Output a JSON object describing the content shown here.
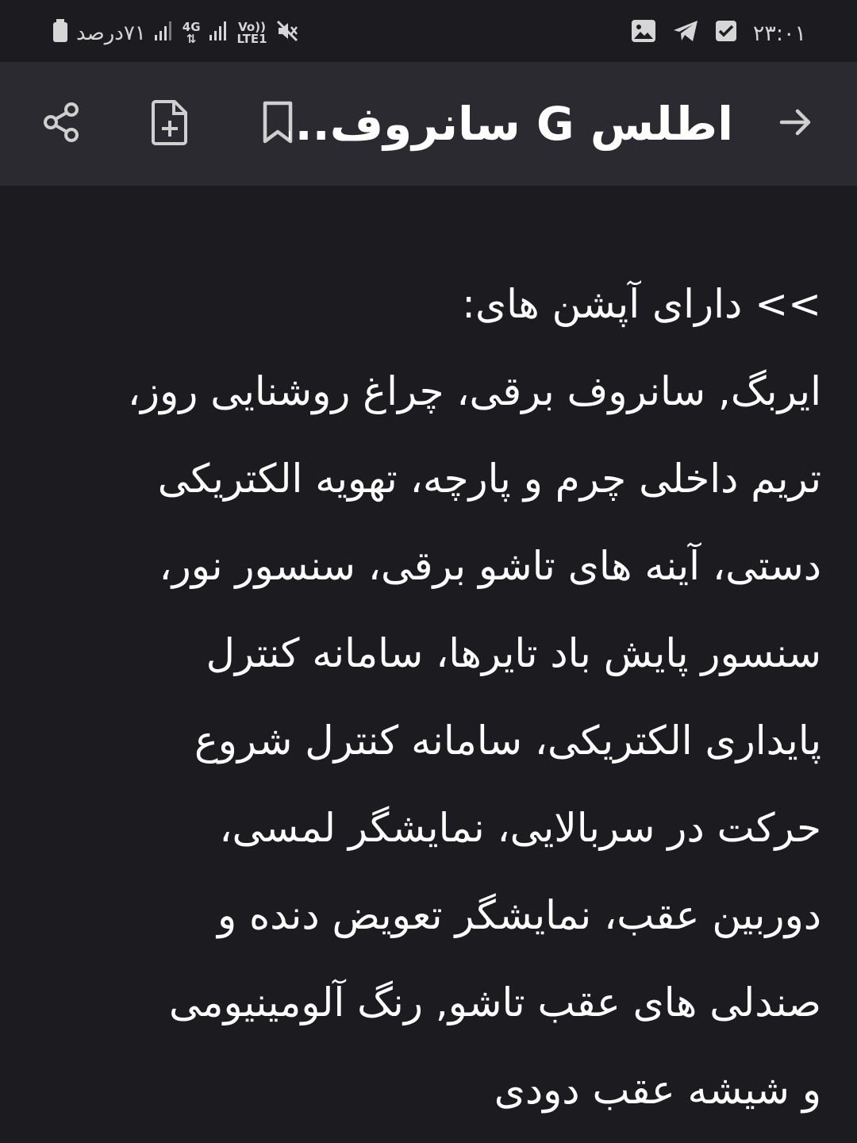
{
  "status_bar": {
    "battery_text": "۷۱درصد",
    "network_label": "4G",
    "volte_top": "Vo))",
    "volte_bottom": "LTE1",
    "time": "۲۳:۰۱",
    "icons": [
      "battery-icon",
      "signal-icon",
      "signal-icon",
      "mute-icon",
      "gallery-icon",
      "telegram-icon",
      "check-icon"
    ]
  },
  "app_bar": {
    "title": "اطلس G سانروف...",
    "icons": [
      "back-arrow-icon",
      "bookmark-icon",
      "add-note-icon",
      "share-icon"
    ]
  },
  "content": {
    "lines": [
      ">> دارای آپشن های:",
      "ایربگ, سانروف برقی، چراغ روشنایی روز،",
      "تریم داخلی چرم و پارچه، تهویه الکتریکی",
      "دستی، آینه های تاشو برقی، سنسور نور،",
      "سنسور پایش باد تایرها، سامانه کنترل",
      "پایداری الکتریکی، سامانه کنترل شروع",
      "حرکت در سربالایی، نمایشگر لمسی،",
      "دوربین عقب، نمایشگر تعویض دنده و",
      "صندلی های عقب تاشو, رنگ آلومینیومی",
      "و شیشه عقب دودی"
    ]
  },
  "colors": {
    "background": "#1c1b20",
    "app_bar": "#2b2a30",
    "text": "#ffffff",
    "icon": "#cfcfcf"
  }
}
